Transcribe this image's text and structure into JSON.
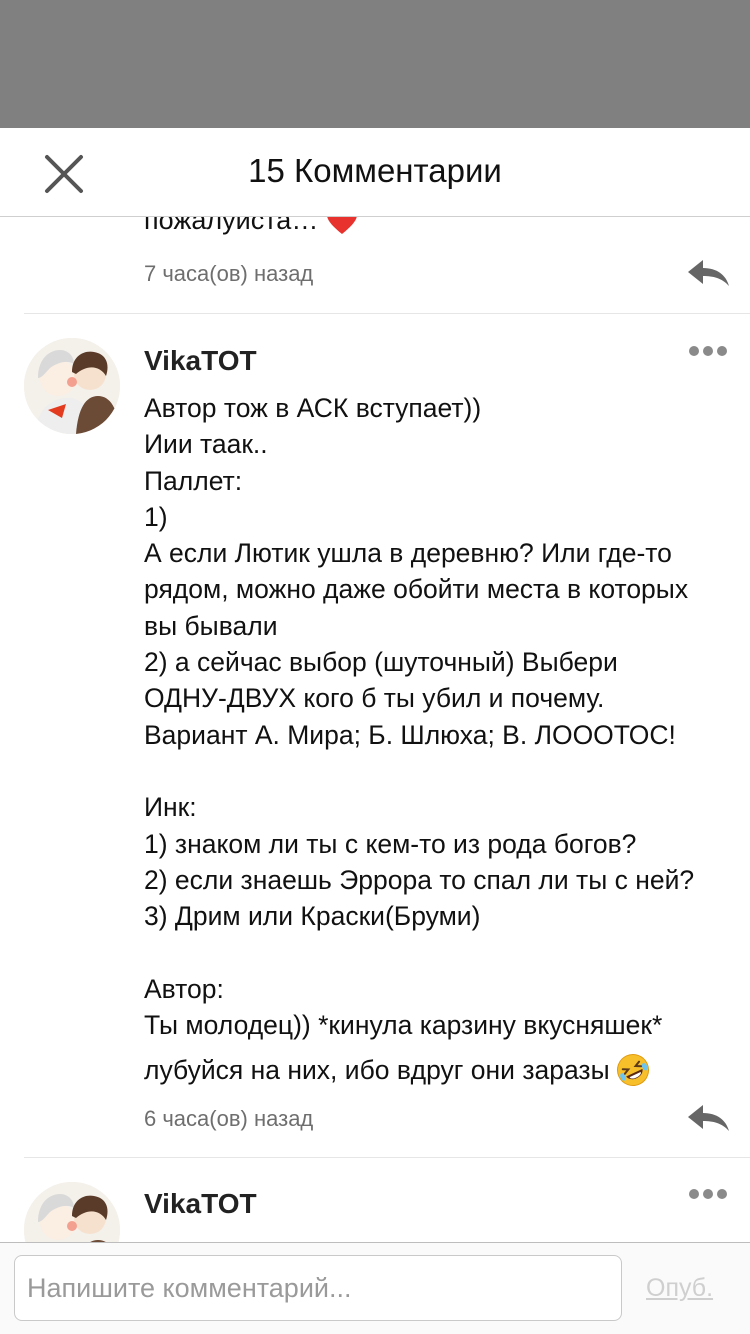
{
  "header": {
    "title": "15 Комментарии"
  },
  "previous_comment": {
    "text_tail": "пожалуйста…",
    "emoji": "heart-icon",
    "time": "7 часа(ов) назад"
  },
  "comments": [
    {
      "username": "VikaTOT",
      "lines": [
        "Автор тож в АСК вступает))",
        "Иии таак..",
        "Паллет:",
        "1)",
        "А если Лютик ушла в деревню? Или где-то",
        "рядом, можно даже обойти места в которых",
        "вы бывали",
        "2) а сейчас выбор (шуточный) Выбери",
        "ОДНУ-ДВУХ кого б ты убил и почему.",
        "Вариант А. Мира; Б. Шлюха; В. ЛОООТОС!",
        "",
        "Инк:",
        "1) знаком ли ты с кем-то из рода богов?",
        "2) если знаешь Эррора то спал ли ты с ней?",
        "3) Дрим или Краски(Бруми)",
        "",
        "Автор:",
        "Ты молодец)) *кинула карзину вкусняшек*"
      ],
      "last_line": "лубуйся на них, ибо вдруг они заразы",
      "last_emoji": "rolling-laughing-emoji-icon",
      "time": "6 часа(ов) назад"
    },
    {
      "username": "VikaTOT"
    }
  ],
  "footer": {
    "input_placeholder": "Напишите комментарий...",
    "publish_label": "Опуб."
  },
  "colors": {
    "overlay": "#808080",
    "heart": "#e8322e",
    "muted_text": "#6e6e6e",
    "icon_gray": "#666666"
  }
}
